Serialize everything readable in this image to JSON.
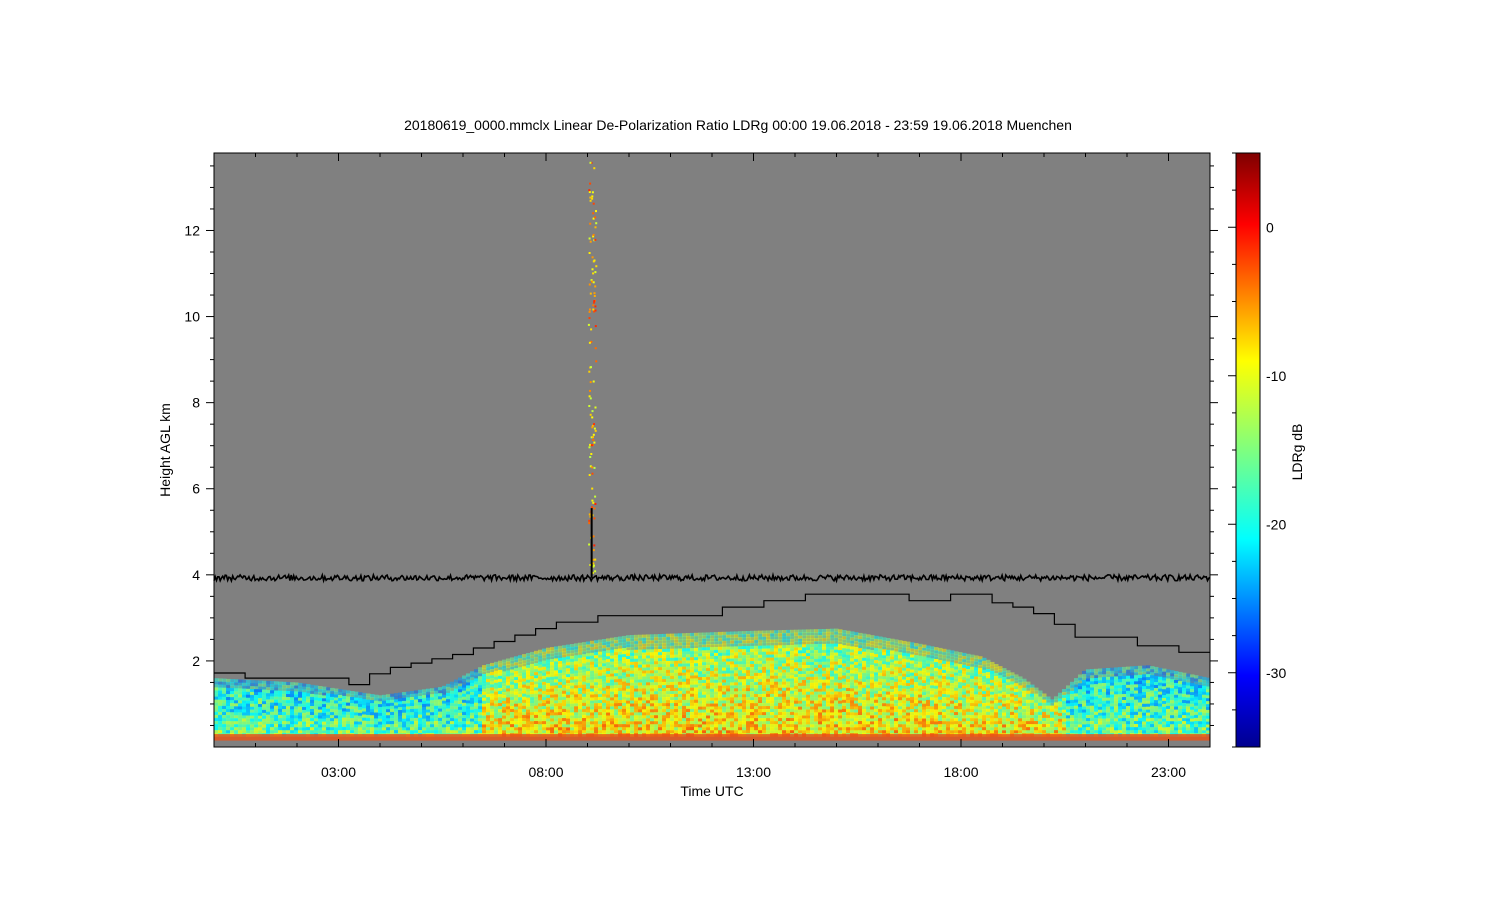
{
  "chart_data": {
    "type": "heatmap",
    "title": "20180619_0000.mmclx Linear De-Polarization Ratio LDRg   00:00 19.06.2018 - 23:59 19.06.2018 Muenchen",
    "xlabel": "Time UTC",
    "ylabel": "Height AGL km",
    "colorbar_label": "LDRg dB",
    "x_range_hours": [
      0.0,
      24.0
    ],
    "y_range_km": [
      0.0,
      13.8
    ],
    "x_ticks": [
      {
        "value": 3,
        "label": "03:00"
      },
      {
        "value": 8,
        "label": "08:00"
      },
      {
        "value": 13,
        "label": "13:00"
      },
      {
        "value": 18,
        "label": "18:00"
      },
      {
        "value": 23,
        "label": "23:00"
      }
    ],
    "y_ticks": [
      {
        "value": 2,
        "label": "2"
      },
      {
        "value": 4,
        "label": "4"
      },
      {
        "value": 6,
        "label": "6"
      },
      {
        "value": 8,
        "label": "8"
      },
      {
        "value": 10,
        "label": "10"
      },
      {
        "value": 12,
        "label": "12"
      }
    ],
    "colorbar_range_db": [
      -35,
      5
    ],
    "colorbar_ticks": [
      {
        "value": 0,
        "label": "0"
      },
      {
        "value": -10,
        "label": "-10"
      },
      {
        "value": -20,
        "label": "-20"
      },
      {
        "value": -30,
        "label": "-30"
      }
    ],
    "background_color": "#808080",
    "colormap": "jet",
    "reference_line_km": 3.93,
    "spike": {
      "time": 9.1,
      "top_km": 5.55
    },
    "boundary_layer_steps": [
      {
        "t": 0.0,
        "h": 1.72
      },
      {
        "t": 0.75,
        "h": 1.6
      },
      {
        "t": 3.25,
        "h": 1.45
      },
      {
        "t": 3.75,
        "h": 1.7
      },
      {
        "t": 4.25,
        "h": 1.85
      },
      {
        "t": 4.75,
        "h": 1.95
      },
      {
        "t": 5.25,
        "h": 2.05
      },
      {
        "t": 5.75,
        "h": 2.15
      },
      {
        "t": 6.25,
        "h": 2.3
      },
      {
        "t": 6.75,
        "h": 2.45
      },
      {
        "t": 7.25,
        "h": 2.6
      },
      {
        "t": 7.75,
        "h": 2.75
      },
      {
        "t": 8.25,
        "h": 2.9
      },
      {
        "t": 9.25,
        "h": 3.05
      },
      {
        "t": 12.25,
        "h": 3.25
      },
      {
        "t": 13.25,
        "h": 3.4
      },
      {
        "t": 14.25,
        "h": 3.55
      },
      {
        "t": 16.75,
        "h": 3.4
      },
      {
        "t": 17.75,
        "h": 3.55
      },
      {
        "t": 18.75,
        "h": 3.35
      },
      {
        "t": 19.25,
        "h": 3.25
      },
      {
        "t": 19.75,
        "h": 3.1
      },
      {
        "t": 20.25,
        "h": 2.85
      },
      {
        "t": 20.75,
        "h": 2.55
      },
      {
        "t": 22.25,
        "h": 2.35
      },
      {
        "t": 23.25,
        "h": 2.2
      },
      {
        "t": 24.0,
        "h": 2.2
      }
    ],
    "echo_top_profile": [
      {
        "t": 0.0,
        "h": 1.6
      },
      {
        "t": 2.0,
        "h": 1.5
      },
      {
        "t": 4.0,
        "h": 1.2
      },
      {
        "t": 5.5,
        "h": 1.4
      },
      {
        "t": 6.5,
        "h": 1.9
      },
      {
        "t": 8.0,
        "h": 2.3
      },
      {
        "t": 10.0,
        "h": 2.6
      },
      {
        "t": 13.0,
        "h": 2.7
      },
      {
        "t": 15.0,
        "h": 2.75
      },
      {
        "t": 17.0,
        "h": 2.4
      },
      {
        "t": 18.5,
        "h": 2.1
      },
      {
        "t": 19.5,
        "h": 1.6
      },
      {
        "t": 20.2,
        "h": 1.1
      },
      {
        "t": 21.0,
        "h": 1.8
      },
      {
        "t": 22.5,
        "h": 1.9
      },
      {
        "t": 24.0,
        "h": 1.6
      }
    ]
  }
}
